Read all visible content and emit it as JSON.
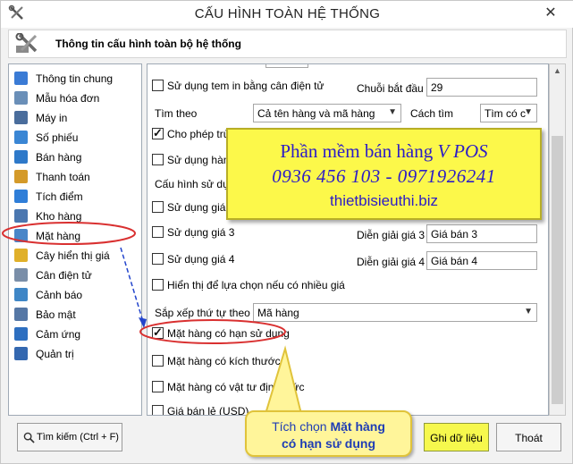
{
  "window": {
    "title": "CẤU HÌNH TOÀN HỆ THỐNG",
    "close_symbol": "✕",
    "header": "Thông tin cấu hình toàn bộ hệ thống"
  },
  "sidebar": {
    "items": [
      {
        "label": "Thông tin chung",
        "icon": "document-icon",
        "color": "#3a7bd5"
      },
      {
        "label": "Mẫu hóa đơn",
        "icon": "invoice-icon",
        "color": "#6a8fb8"
      },
      {
        "label": "Máy in",
        "icon": "printer-icon",
        "color": "#4a6d9c"
      },
      {
        "label": "Số phiếu",
        "icon": "receipt-icon",
        "color": "#3a86d4"
      },
      {
        "label": "Bán hàng",
        "icon": "cart-icon",
        "color": "#2e79c9"
      },
      {
        "label": "Thanh toán",
        "icon": "coins-icon",
        "color": "#d49a2a"
      },
      {
        "label": "Tích điểm",
        "icon": "points-icon",
        "color": "#2f7ed8"
      },
      {
        "label": "Kho hàng",
        "icon": "warehouse-icon",
        "color": "#4b77b0"
      },
      {
        "label": "Mặt hàng",
        "icon": "product-icon",
        "color": "#4a86c8"
      },
      {
        "label": "Cây hiển thị giá",
        "icon": "bulb-icon",
        "color": "#e0b02a"
      },
      {
        "label": "Cân điện tử",
        "icon": "scale-icon",
        "color": "#7a8ea8"
      },
      {
        "label": "Cảnh báo",
        "icon": "warning-icon",
        "color": "#3f86c6"
      },
      {
        "label": "Bảo mật",
        "icon": "lock-icon",
        "color": "#5577a5"
      },
      {
        "label": "Cảm ứng",
        "icon": "touch-icon",
        "color": "#2e6fc0"
      },
      {
        "label": "Quản trị",
        "icon": "admin-icon",
        "color": "#3468b0"
      }
    ],
    "selected_index": 8
  },
  "content": {
    "use_scale_label": "Sử dụng tem in bằng cân điện tử",
    "prefix_label": "Chuỗi bắt đầu",
    "prefix_value": "29",
    "search_by_label": "Tìm theo",
    "search_by_value": "Cả tên hàng và mã hàng",
    "search_mode_label": "Cách tìm",
    "search_mode_value": "Tìm có c",
    "allow_duplicate_label": "Cho phép trùng tên mã h",
    "use_goods_label": "Sử dụng hàng",
    "price_config_label": "Cấu hình sử dụng",
    "price2_label": "Sử dụng giá 2",
    "price3_label": "Sử dụng giá 3",
    "price3_desc_label": "Diễn giải giá 3",
    "price3_desc_value": "Giá bán 3",
    "price4_label": "Sử dụng giá 4",
    "price4_desc_label": "Diễn giải giá 4",
    "price4_desc_value": "Giá bán 4",
    "multi_price_label": "Hiển thị để lựa chọn nếu có nhiều giá",
    "sort_label": "Sắp xếp thứ tự theo",
    "sort_value": "Mã hàng",
    "expiry_label": "Mặt hàng có hạn sử dụng",
    "size_label": "Mặt hàng có kích thước",
    "material_label": "Mặt hàng có vật tư định mức",
    "usd_label": "Giá bán lẻ (USD)"
  },
  "footer": {
    "search_button": "Tìm kiếm (Ctrl + F)",
    "save_button": "Ghi dữ liệu",
    "exit_button": "Thoát"
  },
  "banner": {
    "line1_prefix": "Phần mềm bán hàng ",
    "line1_brand": "V POS",
    "line2": "0936 456 103 - 0971926241",
    "line3": "thietbisieuthi.biz"
  },
  "callout": {
    "prefix": "Tích chọn ",
    "bold1": "Mặt hàng",
    "line2": "có hạn sử dụng"
  },
  "colors": {
    "highlight_red": "#d93030",
    "arrow_blue": "#2244cc",
    "banner_text": "#2c1cc7",
    "save_button_bg": "#f6f84d"
  }
}
